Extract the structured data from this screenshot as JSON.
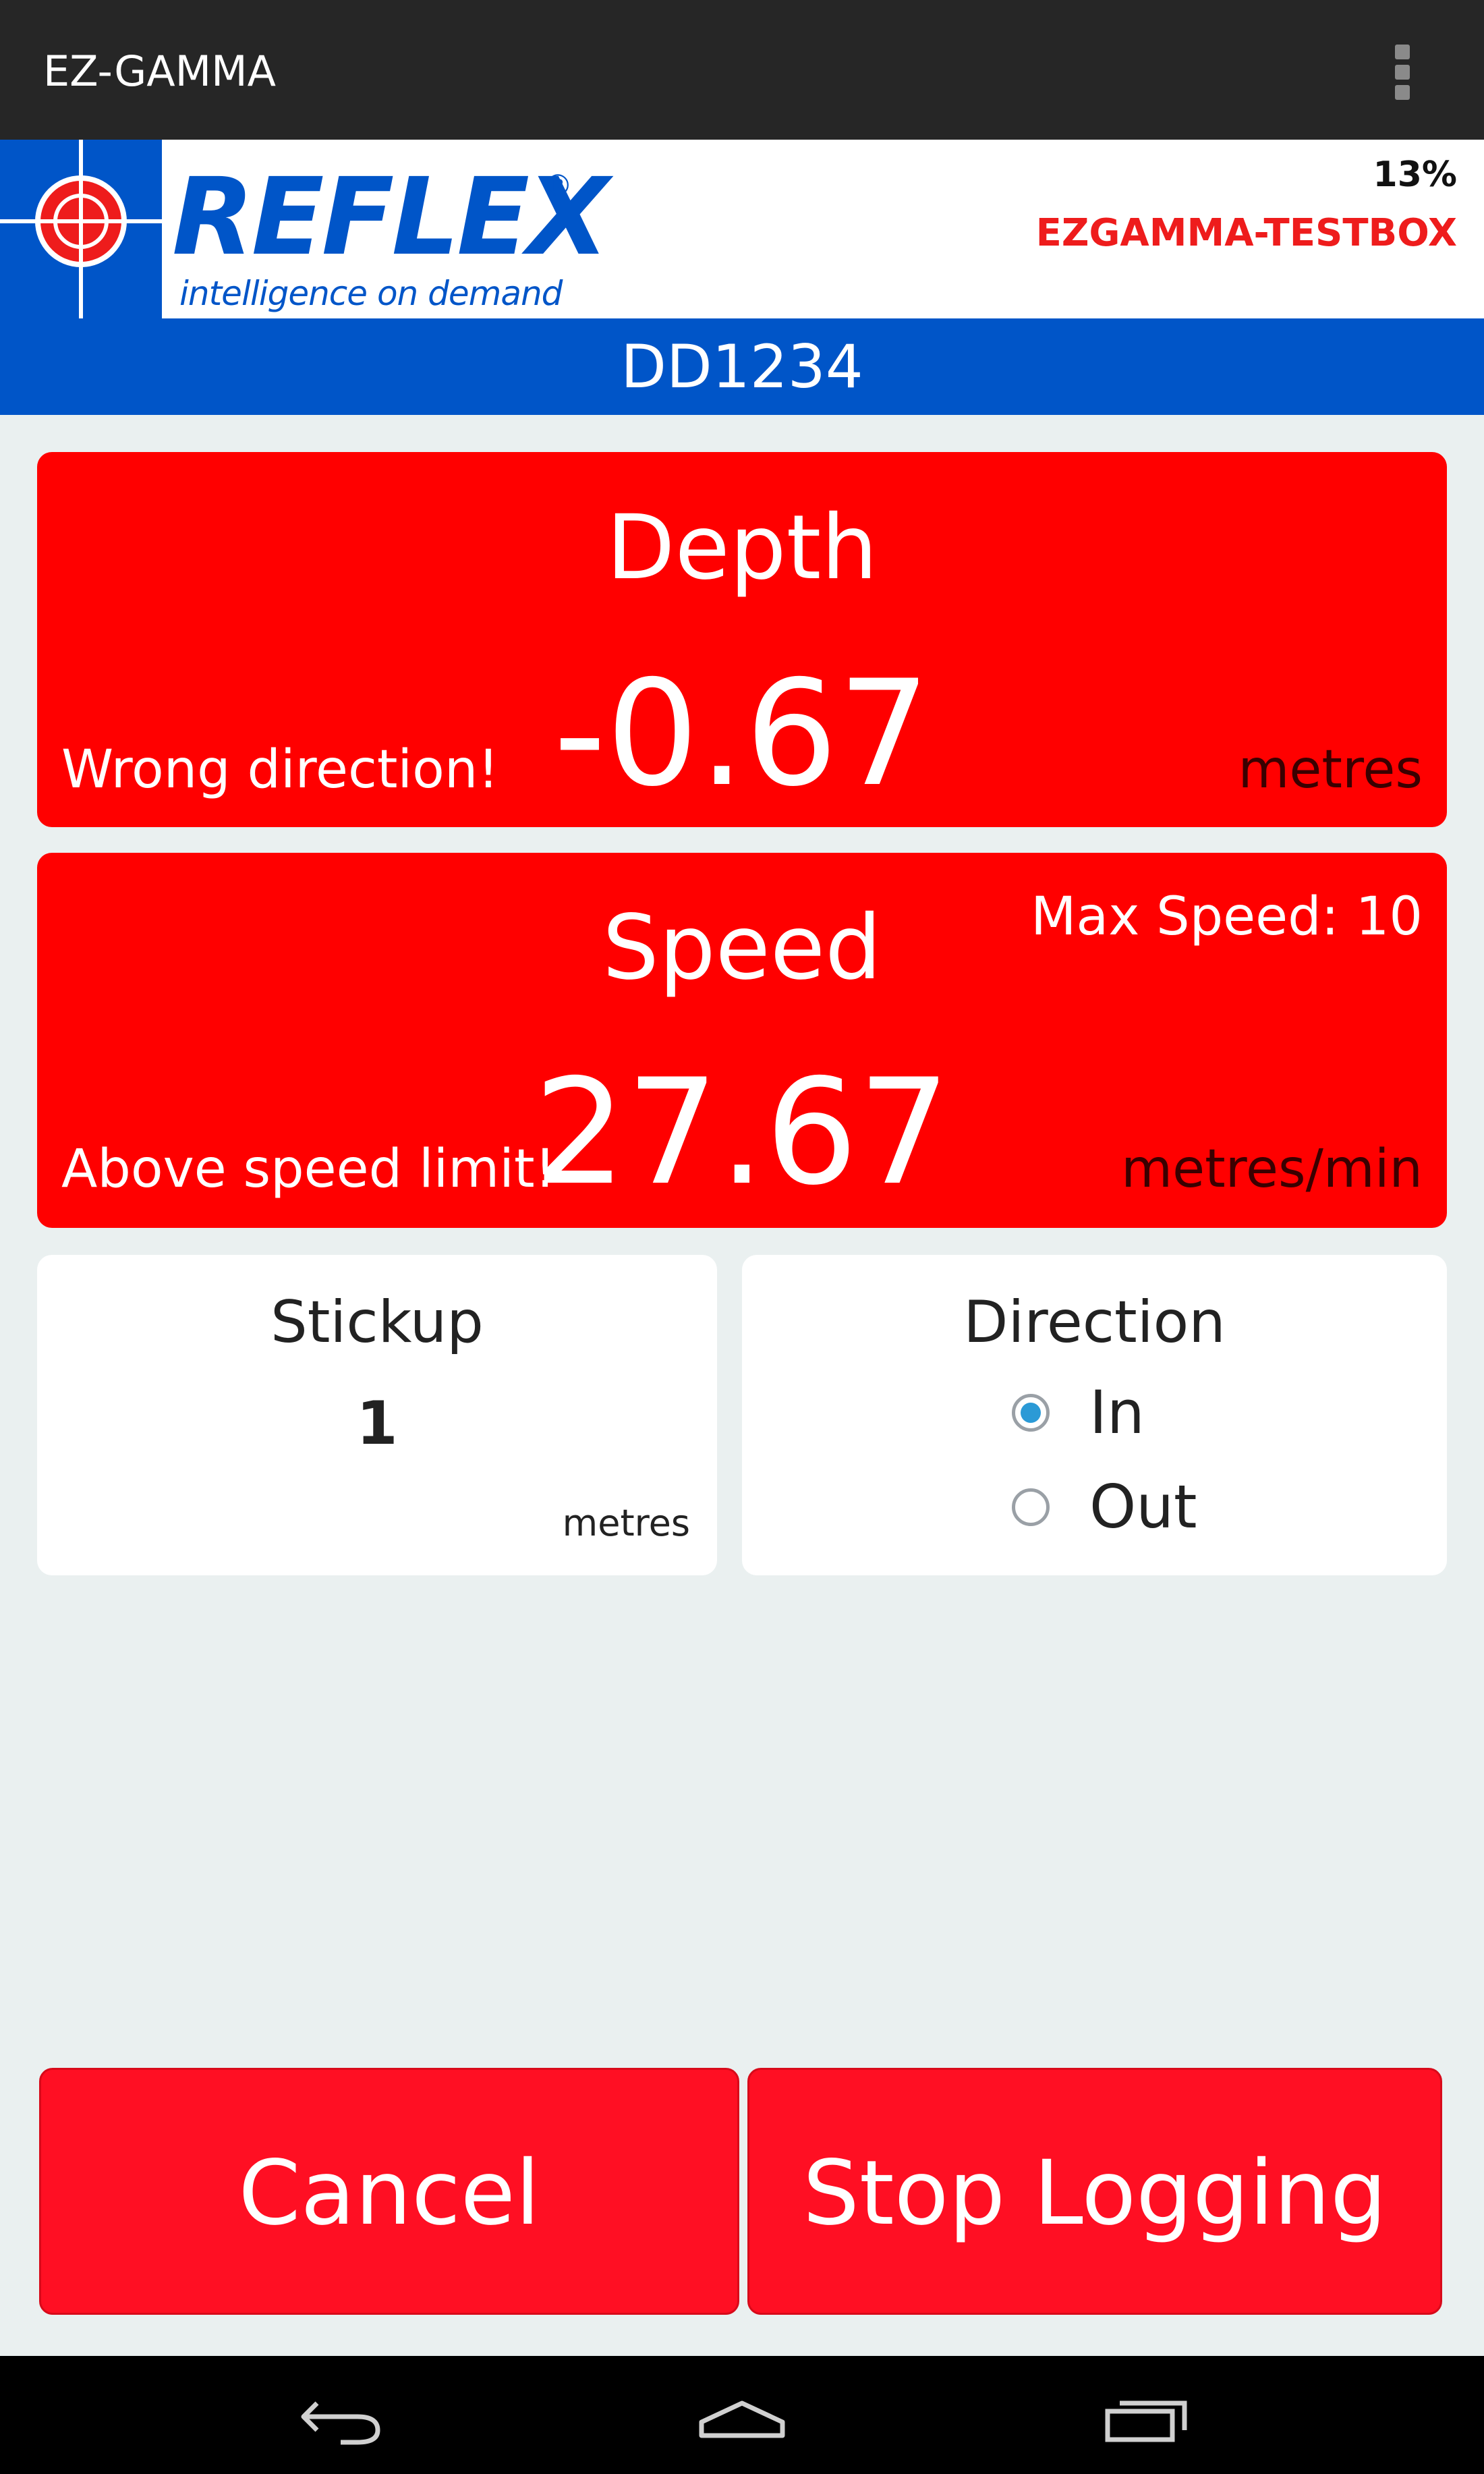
{
  "action_bar": {
    "title": "EZ-GAMMA",
    "overflow_icon": "more-vert-icon"
  },
  "header": {
    "logo": {
      "text": "REFLEX",
      "registered": "®",
      "tagline": "intelligence on demand",
      "brand_color": "#0055c8"
    },
    "battery": "13%",
    "device_name": "EZGAMMA-TESTBOX",
    "device_name_color": "#ee1c1c"
  },
  "hole_id": "DD1234",
  "depth": {
    "title": "Depth",
    "value": "-0.67",
    "warning": "Wrong direction!",
    "unit": "metres"
  },
  "speed": {
    "title": "Speed",
    "value": "27.67",
    "warning": "Above speed limit!",
    "unit": "metres/min",
    "max_speed": "Max Speed: 10"
  },
  "stickup": {
    "title": "Stickup",
    "value": "1",
    "unit": "metres"
  },
  "direction": {
    "title": "Direction",
    "options": [
      {
        "label": "In",
        "selected": true
      },
      {
        "label": "Out",
        "selected": false
      }
    ]
  },
  "buttons": {
    "cancel": "Cancel",
    "stop_logging": "Stop Logging"
  },
  "colors": {
    "alert_red": "#ff0000",
    "button_red": "#ff0f23",
    "radio_selected": "#2b9ad6",
    "background": "#eaf0f0"
  },
  "nav_bar": {
    "icons": [
      "back-icon",
      "home-icon",
      "recent-apps-icon"
    ]
  }
}
